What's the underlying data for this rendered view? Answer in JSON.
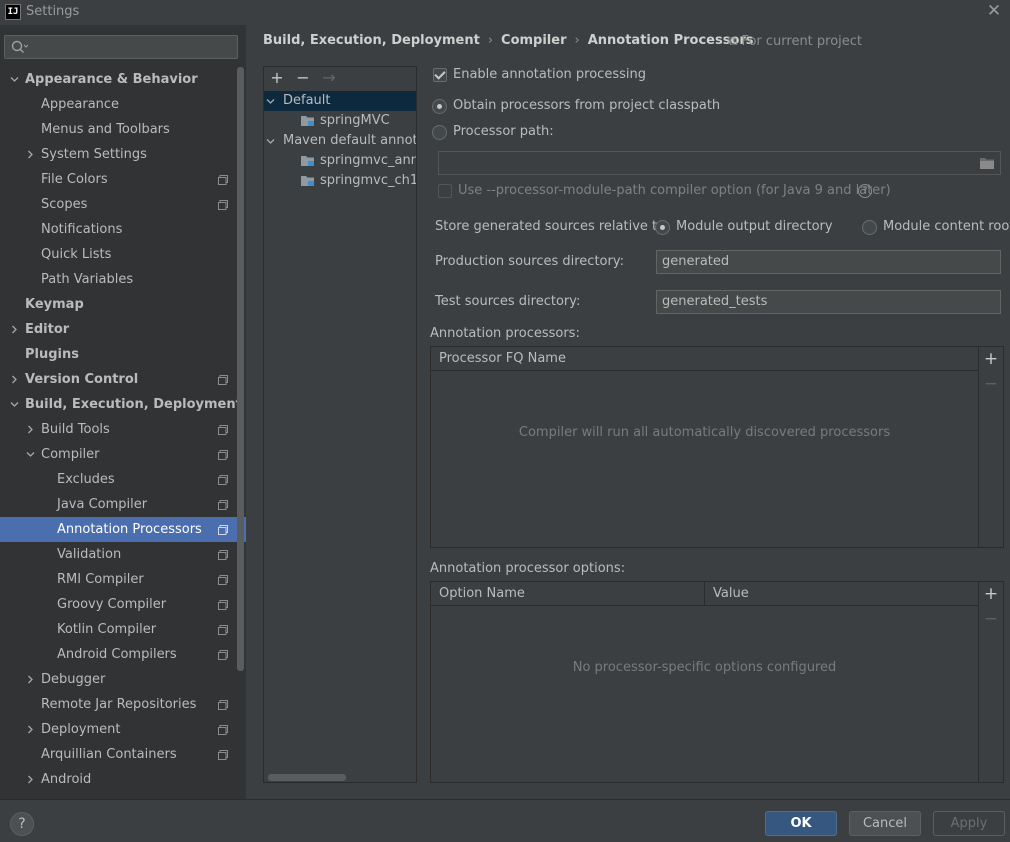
{
  "window": {
    "title": "Settings",
    "logo_text": "IJ"
  },
  "search": {
    "placeholder": ""
  },
  "sidebar": {
    "items": [
      {
        "label": "Appearance & Behavior",
        "bold": true,
        "level": 0,
        "chevron": "down",
        "project": false
      },
      {
        "label": "Appearance",
        "level": 1,
        "project": false
      },
      {
        "label": "Menus and Toolbars",
        "level": 1,
        "project": false
      },
      {
        "label": "System Settings",
        "level": 1,
        "chevron": "right",
        "project": false
      },
      {
        "label": "File Colors",
        "level": 1,
        "project": true
      },
      {
        "label": "Scopes",
        "level": 1,
        "project": true
      },
      {
        "label": "Notifications",
        "level": 1,
        "project": false
      },
      {
        "label": "Quick Lists",
        "level": 1,
        "project": false
      },
      {
        "label": "Path Variables",
        "level": 1,
        "project": false
      },
      {
        "label": "Keymap",
        "bold": true,
        "level": 0,
        "project": false
      },
      {
        "label": "Editor",
        "bold": true,
        "level": 0,
        "chevron": "right",
        "project": false
      },
      {
        "label": "Plugins",
        "bold": true,
        "level": 0,
        "project": false
      },
      {
        "label": "Version Control",
        "bold": true,
        "level": 0,
        "chevron": "right",
        "project": true
      },
      {
        "label": "Build, Execution, Deployment",
        "bold": true,
        "level": 0,
        "chevron": "down",
        "project": false
      },
      {
        "label": "Build Tools",
        "level": 1,
        "chevron": "right",
        "project": true
      },
      {
        "label": "Compiler",
        "level": 1,
        "chevron": "down",
        "project": true
      },
      {
        "label": "Excludes",
        "level": 2,
        "project": true
      },
      {
        "label": "Java Compiler",
        "level": 2,
        "project": true
      },
      {
        "label": "Annotation Processors",
        "level": 2,
        "project": true,
        "selected": true
      },
      {
        "label": "Validation",
        "level": 2,
        "project": true
      },
      {
        "label": "RMI Compiler",
        "level": 2,
        "project": true
      },
      {
        "label": "Groovy Compiler",
        "level": 2,
        "project": true
      },
      {
        "label": "Kotlin Compiler",
        "level": 2,
        "project": true
      },
      {
        "label": "Android Compilers",
        "level": 2,
        "project": true
      },
      {
        "label": "Debugger",
        "level": 1,
        "chevron": "right",
        "project": false
      },
      {
        "label": "Remote Jar Repositories",
        "level": 1,
        "project": true
      },
      {
        "label": "Deployment",
        "level": 1,
        "chevron": "right",
        "project": true
      },
      {
        "label": "Arquillian Containers",
        "level": 1,
        "project": true
      },
      {
        "label": "Android",
        "level": 1,
        "chevron": "right",
        "project": false
      }
    ]
  },
  "breadcrumb": {
    "items": [
      "Build, Execution, Deployment",
      "Compiler",
      "Annotation Processors"
    ],
    "scope": "For current project"
  },
  "profiles": {
    "toolbar": {
      "add": "+",
      "remove": "−",
      "move": "→"
    },
    "rows": [
      {
        "label": "Default",
        "indent": 0,
        "chevron": "down",
        "folder": false,
        "selected": true
      },
      {
        "label": "springMVC",
        "indent": 1,
        "folder": true
      },
      {
        "label": "Maven default annotation processors profile",
        "indent": 0,
        "chevron": "down",
        "folder": false
      },
      {
        "label": "springmvc_annotation",
        "indent": 1,
        "folder": true
      },
      {
        "label": "springmvc_ch1",
        "indent": 1,
        "folder": true
      }
    ]
  },
  "settings": {
    "enable_label": "Enable annotation processing",
    "enable_checked": true,
    "obtain_label": "Obtain processors from project classpath",
    "processor_path_label": "Processor path:",
    "processor_path_value": "",
    "module_path_label": "Use --processor-module-path compiler option (for Java 9 and later)",
    "store_label": "Store generated sources relative to:",
    "store_option_module_output": "Module output directory",
    "store_option_content_root": "Module content root",
    "production_label": "Production sources directory:",
    "production_value": "generated",
    "test_label": "Test sources directory:",
    "test_value": "generated_tests"
  },
  "processors_table": {
    "title": "Annotation processors:",
    "column": "Processor FQ Name",
    "empty_text": "Compiler will run all automatically discovered processors"
  },
  "options_table": {
    "title": "Annotation processor options:",
    "columns": [
      "Option Name",
      "Value"
    ],
    "empty_text": "No processor-specific options configured"
  },
  "footer": {
    "help": "?",
    "ok": "OK",
    "cancel": "Cancel",
    "apply": "Apply"
  },
  "colors": {
    "selection": "#4b6eaf",
    "ok_button": "#365880",
    "background": "#3c3f41",
    "sidebar": "#313335"
  }
}
